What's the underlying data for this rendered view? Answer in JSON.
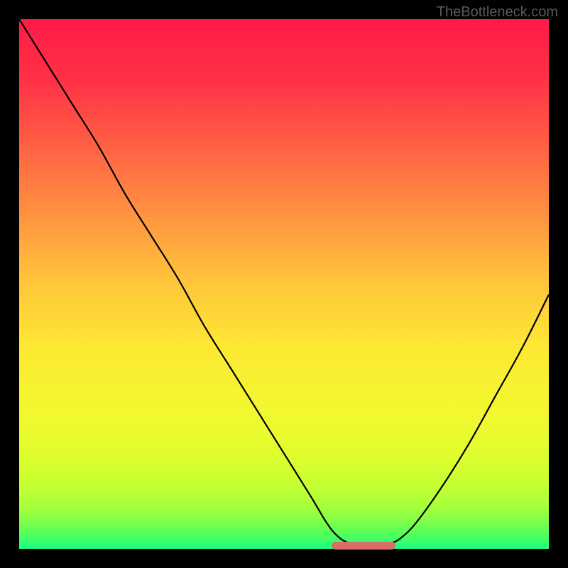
{
  "watermark": "TheBottleneck.com",
  "chart_data": {
    "type": "line",
    "title": "",
    "xlabel": "",
    "ylabel": "",
    "xlim": [
      0,
      100
    ],
    "ylim": [
      0,
      100
    ],
    "grid": false,
    "series": [
      {
        "name": "bottleneck-curve",
        "x": [
          0,
          5,
          10,
          15,
          20,
          25,
          30,
          35,
          40,
          45,
          50,
          55,
          58,
          60,
          62,
          65,
          68,
          70,
          72,
          75,
          80,
          85,
          90,
          95,
          100
        ],
        "values": [
          100,
          92,
          84,
          76,
          67,
          59,
          51,
          42,
          34,
          26,
          18,
          10,
          5,
          2.5,
          1.2,
          0.5,
          0.5,
          1,
          2,
          5,
          12,
          20,
          29,
          38,
          48
        ]
      }
    ],
    "marker": {
      "name": "optimal-range",
      "x_start": 59,
      "x_end": 71,
      "y": 0.6,
      "color": "#db6e68"
    },
    "background_gradient": {
      "stops": [
        {
          "pos": 0.0,
          "color": "#ff1a47"
        },
        {
          "pos": 0.12,
          "color": "#ff3346"
        },
        {
          "pos": 0.25,
          "color": "#ff6544"
        },
        {
          "pos": 0.38,
          "color": "#ff9740"
        },
        {
          "pos": 0.5,
          "color": "#ffc63a"
        },
        {
          "pos": 0.62,
          "color": "#fde834"
        },
        {
          "pos": 0.74,
          "color": "#f3f82f"
        },
        {
          "pos": 0.82,
          "color": "#e0fd2e"
        },
        {
          "pos": 0.88,
          "color": "#c5ff33"
        },
        {
          "pos": 0.92,
          "color": "#a6ff3b"
        },
        {
          "pos": 0.95,
          "color": "#7dff49"
        },
        {
          "pos": 0.975,
          "color": "#4dff5e"
        },
        {
          "pos": 1.0,
          "color": "#1bff84"
        }
      ]
    }
  }
}
